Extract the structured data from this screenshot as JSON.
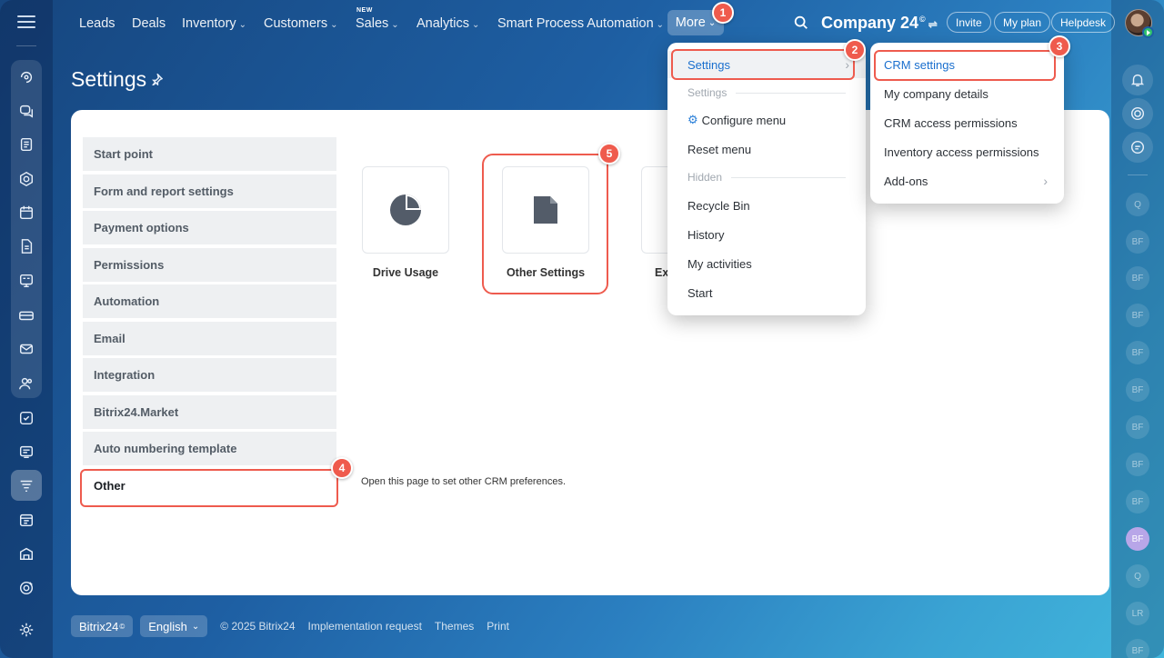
{
  "topnav": {
    "items": [
      "Leads",
      "Deals",
      "Inventory",
      "Customers",
      "Sales",
      "Analytics",
      "Smart Process Automation"
    ],
    "new_tag": "NEW",
    "more_label": "More",
    "company": "Company 24",
    "company_mark": "©",
    "invite": "Invite",
    "my_plan": "My plan",
    "helpdesk": "Helpdesk"
  },
  "page": {
    "title": "Settings"
  },
  "settings_menu": [
    "Start point",
    "Form and report settings",
    "Payment options",
    "Permissions",
    "Automation",
    "Email",
    "Integration",
    "Bitrix24.Market",
    "Auto numbering template",
    "Other"
  ],
  "selected_menu": "Other",
  "tiles": [
    "Drive Usage",
    "Other Settings",
    "Ex"
  ],
  "description": "Open this page to set other CRM preferences.",
  "more_dropdown": {
    "settings": "Settings",
    "settings_header": "Settings",
    "configure_menu": "Configure menu",
    "reset_menu": "Reset menu",
    "hidden_header": "Hidden",
    "recycle_bin": "Recycle Bin",
    "history": "History",
    "my_activities": "My activities",
    "start": "Start"
  },
  "settings_submenu": [
    "CRM settings",
    "My company details",
    "CRM access permissions",
    "Inventory access permissions",
    "Add-ons"
  ],
  "badges": [
    "1",
    "2",
    "3",
    "4",
    "5"
  ],
  "right_rail_bubbles": [
    "Q",
    "BF",
    "BF",
    "BF",
    "BF",
    "BF",
    "BF",
    "BF",
    "BF",
    "BF",
    "Q",
    "LR",
    "BF"
  ],
  "footer": {
    "brand": "Bitrix24",
    "brand_mark": "©",
    "language": "English",
    "copyright": "© 2025 Bitrix24",
    "implementation": "Implementation request",
    "themes": "Themes",
    "print": "Print"
  },
  "colors": {
    "accent": "#1a6fce",
    "highlight": "#ee5b4e",
    "card_bg": "#ffffff"
  }
}
